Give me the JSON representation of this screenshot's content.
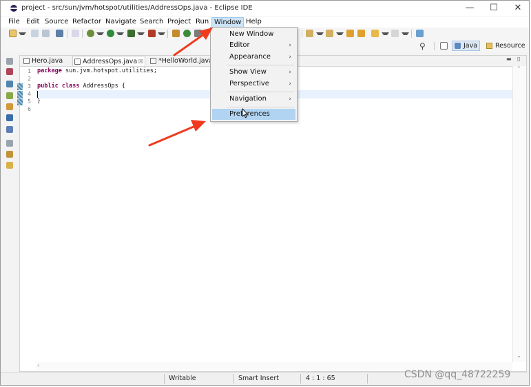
{
  "window": {
    "title": "project - src/sun/jvm/hotspot/utilities/AddressOps.java - Eclipse IDE",
    "minimize": "—",
    "maximize": "☐",
    "close": "✕"
  },
  "menubar": {
    "items": [
      "File",
      "Edit",
      "Source",
      "Refactor",
      "Navigate",
      "Search",
      "Project",
      "Run",
      "Window",
      "Help"
    ],
    "active": "Window"
  },
  "window_menu": {
    "items": [
      {
        "label": "New Window",
        "submenu": false
      },
      {
        "label": "Editor",
        "submenu": true
      },
      {
        "label": "Appearance",
        "submenu": true
      },
      {
        "label": "Show View",
        "submenu": true
      },
      {
        "label": "Perspective",
        "submenu": true
      },
      {
        "label": "Navigation",
        "submenu": true
      },
      {
        "label": "Preferences",
        "submenu": false,
        "highlighted": true
      }
    ],
    "chevron": "›"
  },
  "perspectives": {
    "java": "Java",
    "resource": "Resource"
  },
  "editor": {
    "tabs": [
      {
        "label": "Hero.java",
        "active": false
      },
      {
        "label": "AddressOps.java",
        "active": true,
        "close": "☒"
      },
      {
        "label": "*HelloWorld.java",
        "active": false
      }
    ],
    "line_numbers": [
      "1",
      "2",
      "3",
      "4",
      "5",
      "6"
    ],
    "code": {
      "line1_kw": "package",
      "line1_rest": " sun.jvm.hotspot.utilities;",
      "line3_kw1": "public",
      "line3_kw2": "class",
      "line3_rest": " AddressOps {",
      "line5": "}"
    }
  },
  "statusbar": {
    "writable": "Writable",
    "insert_mode": "Smart Insert",
    "position": "4 : 1 : 65"
  },
  "watermark": "CSDN @qq_48722259",
  "colors": {
    "annotation_arrow": "#f03a1e",
    "menu_highlight": "#b0d4f1",
    "keyword": "#7f0055"
  }
}
